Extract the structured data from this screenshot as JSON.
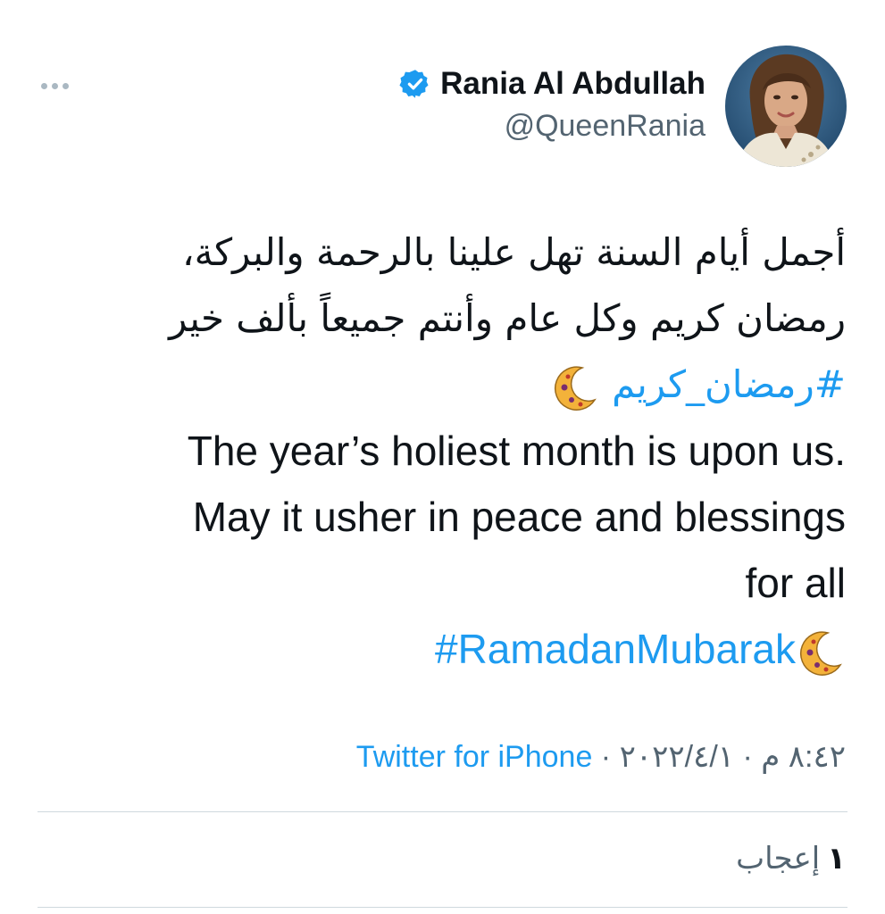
{
  "author": {
    "display_name": "Rania Al Abdullah",
    "handle": "@QueenRania",
    "verified": true
  },
  "tweet": {
    "arabic_line_1": "أجمل أيام السنة تهل علينا بالرحمة والبركة،",
    "arabic_line_2": "رمضان كريم وكل عام وأنتم جميعاً بألف خير",
    "arabic_hashtag": "#رمضان_كريم",
    "english_line_1": "The year’s holiest month is upon us.",
    "english_line_2": "May it usher in peace and blessings",
    "english_line_3": "for all",
    "english_hashtag": "#RamadanMubarak",
    "emoji_icon": "crescent-moon-icon"
  },
  "meta": {
    "date": "٢٠٢٢/٤/١",
    "time": "٨:٤٢ م",
    "separator": " · ",
    "source": "Twitter for iPhone"
  },
  "engagement": {
    "likes_count": "١",
    "likes_label": "إعجاب"
  },
  "colors": {
    "accent": "#1d9bf0",
    "text": "#0f1419",
    "secondary": "#536471",
    "divider": "#cfd9de"
  }
}
